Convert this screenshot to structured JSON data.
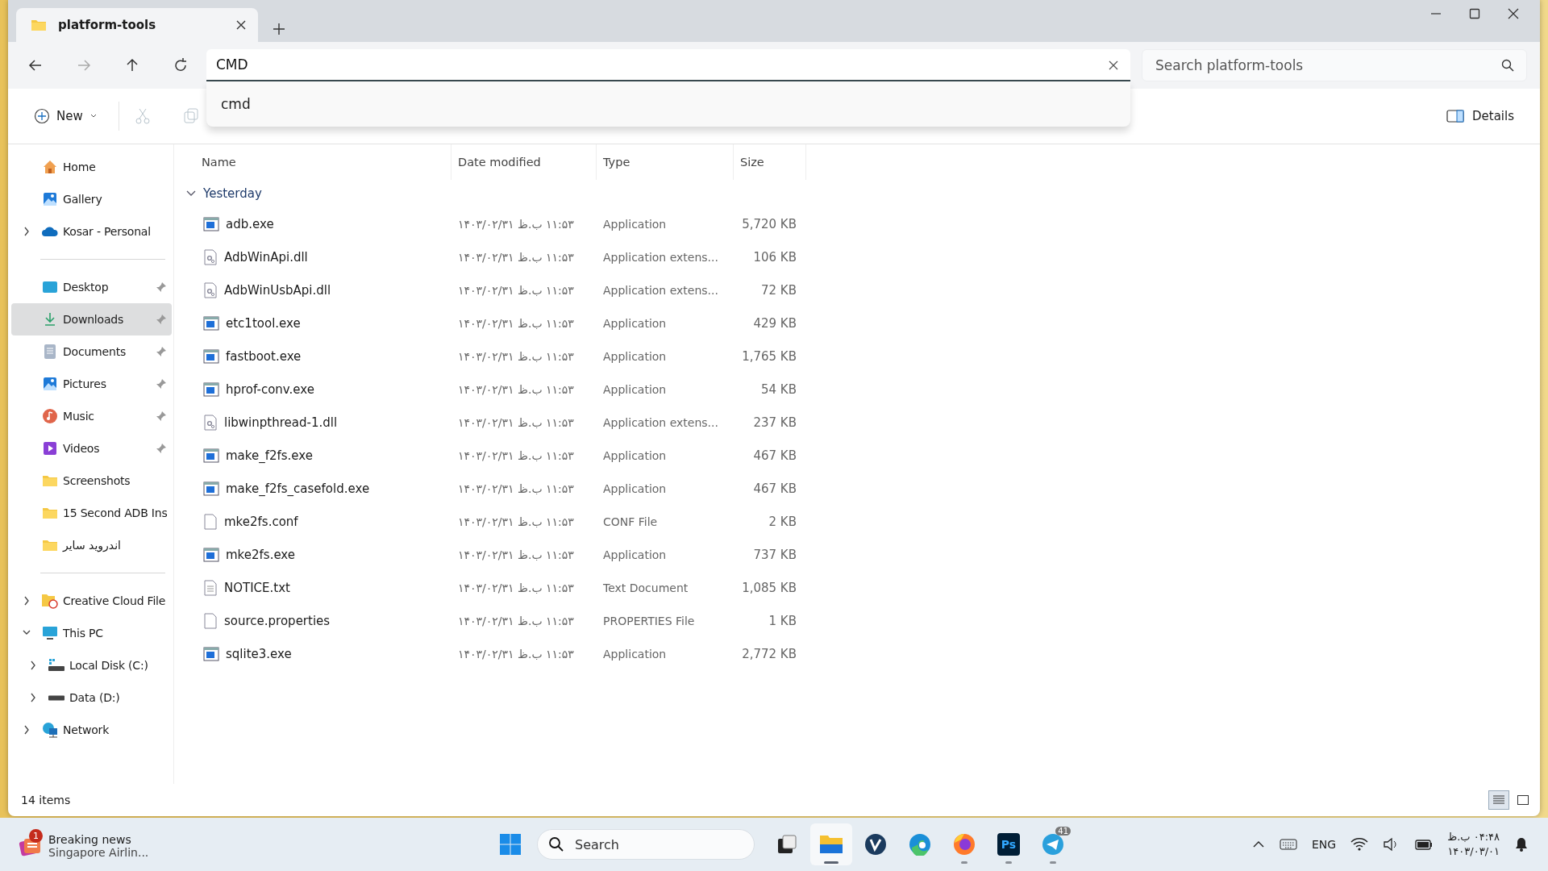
{
  "window": {
    "tab_title": "platform-tools"
  },
  "address_bar": {
    "value": "CMD",
    "suggestions": [
      "cmd"
    ]
  },
  "search": {
    "placeholder": "Search platform-tools"
  },
  "toolbar": {
    "new_label": "New",
    "details_label": "Details"
  },
  "sidebar": {
    "groups": [
      [
        {
          "label": "Home",
          "kind": "home",
          "selected": false,
          "pinned": false
        },
        {
          "label": "Gallery",
          "kind": "gallery",
          "selected": false,
          "pinned": false
        },
        {
          "label": "Kosar - Personal",
          "kind": "cloud",
          "selected": false,
          "pinned": false,
          "expanded": false
        }
      ],
      [
        {
          "label": "Desktop",
          "kind": "desktop",
          "selected": false,
          "pinned": true
        },
        {
          "label": "Downloads",
          "kind": "download",
          "selected": true,
          "pinned": true
        },
        {
          "label": "Documents",
          "kind": "document",
          "selected": false,
          "pinned": true
        },
        {
          "label": "Pictures",
          "kind": "gallery",
          "selected": false,
          "pinned": true
        },
        {
          "label": "Music",
          "kind": "music",
          "selected": false,
          "pinned": true
        },
        {
          "label": "Videos",
          "kind": "video",
          "selected": false,
          "pinned": true
        },
        {
          "label": "Screenshots",
          "kind": "folder",
          "selected": false,
          "pinned": false
        },
        {
          "label": "15 Second ADB Ins",
          "kind": "folder",
          "selected": false,
          "pinned": false
        },
        {
          "label": "اندروید سایر",
          "kind": "folder",
          "selected": false,
          "pinned": false
        }
      ],
      [
        {
          "label": "Creative Cloud File",
          "kind": "ccfolder",
          "selected": false,
          "pinned": false,
          "expanded": false
        },
        {
          "label": "This PC",
          "kind": "pc",
          "selected": false,
          "pinned": false,
          "expanded": true,
          "children": [
            {
              "label": "Local Disk (C:)",
              "kind": "sysdisk",
              "selected": false,
              "pinned": false,
              "expanded": false
            },
            {
              "label": "Data (D:)",
              "kind": "disk",
              "selected": false,
              "pinned": false,
              "expanded": false
            }
          ]
        },
        {
          "label": "Network",
          "kind": "network",
          "selected": false,
          "pinned": false,
          "expanded": false
        }
      ]
    ]
  },
  "file_list": {
    "columns": [
      "Name",
      "Date modified",
      "Type",
      "Size"
    ],
    "group": {
      "label": "Yesterday",
      "expanded": true
    },
    "rows": [
      {
        "name": "adb.exe",
        "kind": "exe",
        "date": "۱۱:۵۳ ب.ظ ۱۴۰۳/۰۲/۳۱",
        "type": "Application",
        "size": "5,720 KB"
      },
      {
        "name": "AdbWinApi.dll",
        "kind": "dll",
        "date": "۱۱:۵۳ ب.ظ ۱۴۰۳/۰۲/۳۱",
        "type": "Application extens...",
        "size": "106 KB"
      },
      {
        "name": "AdbWinUsbApi.dll",
        "kind": "dll",
        "date": "۱۱:۵۳ ب.ظ ۱۴۰۳/۰۲/۳۱",
        "type": "Application extens...",
        "size": "72 KB"
      },
      {
        "name": "etc1tool.exe",
        "kind": "exe",
        "date": "۱۱:۵۳ ب.ظ ۱۴۰۳/۰۲/۳۱",
        "type": "Application",
        "size": "429 KB"
      },
      {
        "name": "fastboot.exe",
        "kind": "exe",
        "date": "۱۱:۵۳ ب.ظ ۱۴۰۳/۰۲/۳۱",
        "type": "Application",
        "size": "1,765 KB"
      },
      {
        "name": "hprof-conv.exe",
        "kind": "exe",
        "date": "۱۱:۵۳ ب.ظ ۱۴۰۳/۰۲/۳۱",
        "type": "Application",
        "size": "54 KB"
      },
      {
        "name": "libwinpthread-1.dll",
        "kind": "dll",
        "date": "۱۱:۵۳ ب.ظ ۱۴۰۳/۰۲/۳۱",
        "type": "Application extens...",
        "size": "237 KB"
      },
      {
        "name": "make_f2fs.exe",
        "kind": "exe",
        "date": "۱۱:۵۳ ب.ظ ۱۴۰۳/۰۲/۳۱",
        "type": "Application",
        "size": "467 KB"
      },
      {
        "name": "make_f2fs_casefold.exe",
        "kind": "exe",
        "date": "۱۱:۵۳ ب.ظ ۱۴۰۳/۰۲/۳۱",
        "type": "Application",
        "size": "467 KB"
      },
      {
        "name": "mke2fs.conf",
        "kind": "file",
        "date": "۱۱:۵۳ ب.ظ ۱۴۰۳/۰۲/۳۱",
        "type": "CONF File",
        "size": "2 KB"
      },
      {
        "name": "mke2fs.exe",
        "kind": "exe",
        "date": "۱۱:۵۳ ب.ظ ۱۴۰۳/۰۲/۳۱",
        "type": "Application",
        "size": "737 KB"
      },
      {
        "name": "NOTICE.txt",
        "kind": "txt",
        "date": "۱۱:۵۳ ب.ظ ۱۴۰۳/۰۲/۳۱",
        "type": "Text Document",
        "size": "1,085 KB"
      },
      {
        "name": "source.properties",
        "kind": "file",
        "date": "۱۱:۵۳ ب.ظ ۱۴۰۳/۰۲/۳۱",
        "type": "PROPERTIES File",
        "size": "1 KB"
      },
      {
        "name": "sqlite3.exe",
        "kind": "exe",
        "date": "۱۱:۵۳ ب.ظ ۱۴۰۳/۰۲/۳۱",
        "type": "Application",
        "size": "2,772 KB"
      }
    ]
  },
  "status_bar": {
    "item_count": "14 items",
    "views": [
      {
        "kind": "details",
        "selected": true
      },
      {
        "kind": "tiles",
        "selected": false
      }
    ]
  },
  "taskbar": {
    "news": {
      "badge": "1",
      "title": "Breaking news",
      "subtitle": "Singapore Airlin..."
    },
    "search_placeholder": "Search",
    "apps": [
      {
        "kind": "taskview",
        "active": false,
        "running": false
      },
      {
        "kind": "explorer",
        "active": true,
        "running": true
      },
      {
        "kind": "vivaldi",
        "active": false,
        "running": false
      },
      {
        "kind": "edge",
        "active": false,
        "running": false
      },
      {
        "kind": "firefox",
        "active": false,
        "running": true
      },
      {
        "kind": "photoshop",
        "label": "Ps",
        "active": false,
        "running": true
      },
      {
        "kind": "telegram",
        "badge": "41",
        "active": false,
        "running": true
      }
    ],
    "language": "ENG",
    "time": "۰۴:۴۸ ب.ظ",
    "date": "۱۴۰۳/۰۳/۰۱"
  }
}
